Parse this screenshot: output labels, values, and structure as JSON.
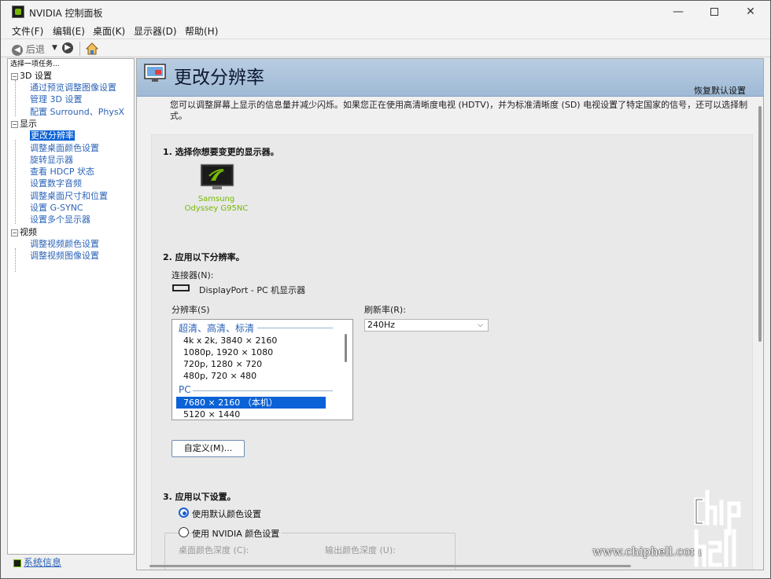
{
  "window": {
    "title": "NVIDIA 控制面板",
    "minimize": "—",
    "close": "✕"
  },
  "menu": [
    "文件(F)",
    "编辑(E)",
    "桌面(K)",
    "显示器(D)",
    "帮助(H)"
  ],
  "toolbar": {
    "back_label": "后退"
  },
  "left_panel": {
    "task_header": "选择一项任务...",
    "categories": [
      {
        "label": "3D 设置",
        "items": [
          "通过预览调整图像设置",
          "管理 3D 设置",
          "配置 Surround、PhysX"
        ]
      },
      {
        "label": "显示",
        "items": [
          "更改分辨率",
          "调整桌面颜色设置",
          "旋转显示器",
          "查看 HDCP 状态",
          "设置数字音频",
          "调整桌面尺寸和位置",
          "设置 G-SYNC",
          "设置多个显示器"
        ]
      },
      {
        "label": "视频",
        "items": [
          "调整视频颜色设置",
          "调整视频图像设置"
        ]
      }
    ],
    "selected_item": "更改分辨率",
    "system_info": "系统信息"
  },
  "main": {
    "page_title": "更改分辨率",
    "restore_defaults": "恢复默认设置",
    "description": "您可以调整屏幕上显示的信息量并减少闪烁。如果您正在使用高清晰度电视 (HDTV)，并为标准清晰度 (SD) 电视设置了特定国家的信号，还可以选择制式。",
    "step1": "1.  选择你想要变更的显示器。",
    "monitor_name": "Samsung Odyssey G95NC",
    "step2": "2.  应用以下分辨率。",
    "connector_label": "连接器(N):",
    "connector_value": "DisplayPort - PC 机显示器",
    "resolution_label": "分辨率(S)",
    "refresh_label": "刷新率(R):",
    "refresh_value": "240Hz",
    "resolution_groups": [
      {
        "name": "超清、高清、标清",
        "items": [
          "4k x 2k, 3840 × 2160",
          "1080p, 1920 × 1080",
          "720p, 1280 × 720",
          "480p, 720 × 480"
        ]
      },
      {
        "name": "PC",
        "items": [
          "7680 × 2160 （本机）",
          "5120 × 1440"
        ]
      }
    ],
    "selected_resolution": "7680 × 2160 （本机）",
    "customize_button": "自定义(M)...",
    "step3": "3.  应用以下设置。",
    "radio_default": "使用默认颜色设置",
    "radio_nvidia": "使用 NVIDIA 颜色设置",
    "desktop_color_depth": "桌面颜色深度 (C):",
    "output_color_depth": "输出颜色深度 (U):"
  },
  "watermark": {
    "text": "www.chiphell.com",
    "logo": "chip hell"
  },
  "colors": {
    "nvidia_green": "#76b900",
    "link_blue": "#2b63b8",
    "select_blue": "#0a62d6",
    "banner": "#a9c2dc"
  }
}
